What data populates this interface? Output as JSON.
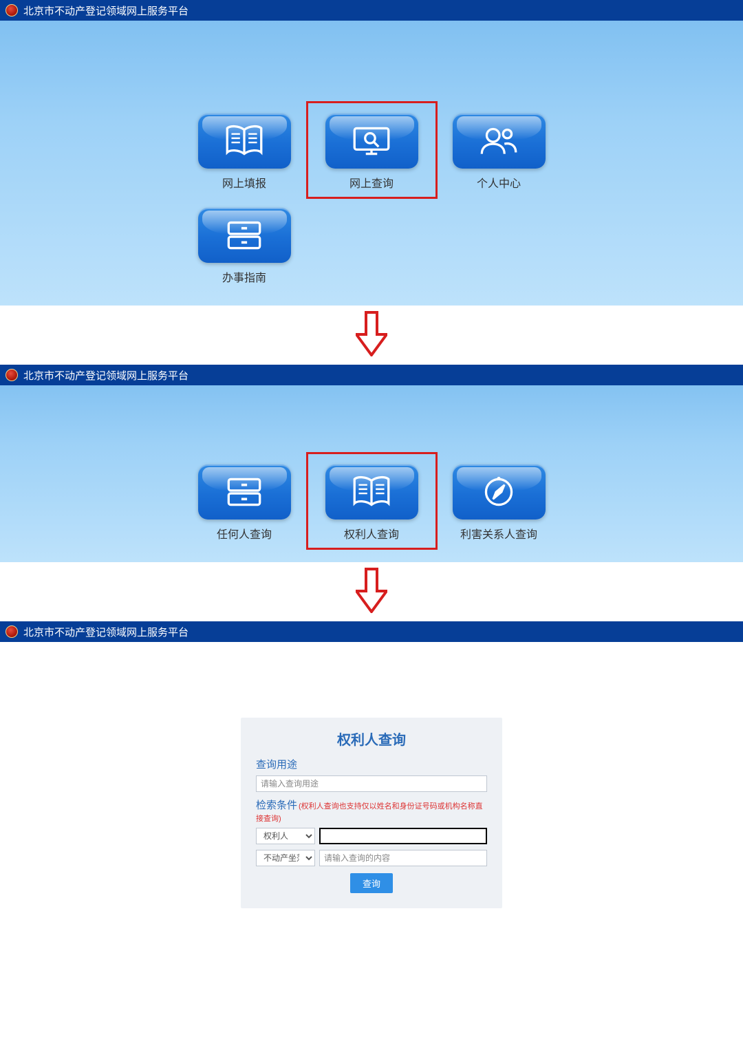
{
  "app_title": "北京市不动产登记领域网上服务平台",
  "panel1": {
    "tiles": [
      {
        "id": "online-fill",
        "label": "网上填报",
        "icon": "book"
      },
      {
        "id": "online-query",
        "label": "网上查询",
        "icon": "monitor-search",
        "highlighted": true
      },
      {
        "id": "user-center",
        "label": "个人中心",
        "icon": "users"
      },
      {
        "id": "guide",
        "label": "办事指南",
        "icon": "archive"
      }
    ]
  },
  "panel2": {
    "tiles": [
      {
        "id": "anyone-query",
        "label": "任何人查询",
        "icon": "archive"
      },
      {
        "id": "owner-query",
        "label": "权利人查询",
        "icon": "book",
        "highlighted": true
      },
      {
        "id": "stakeholder-query",
        "label": "利害关系人查询",
        "icon": "compass"
      }
    ]
  },
  "form": {
    "title": "权利人查询",
    "usage_label": "查询用途",
    "usage_placeholder": "请输入查询用途",
    "criteria_label": "检索条件",
    "criteria_hint": "(权利人查询也支持仅以姓名和身份证号码或机构名称直接查询)",
    "select1": "权利人",
    "select2": "不动产坐落",
    "value1": "",
    "value2_placeholder": "请输入查询的内容",
    "submit": "查询"
  }
}
